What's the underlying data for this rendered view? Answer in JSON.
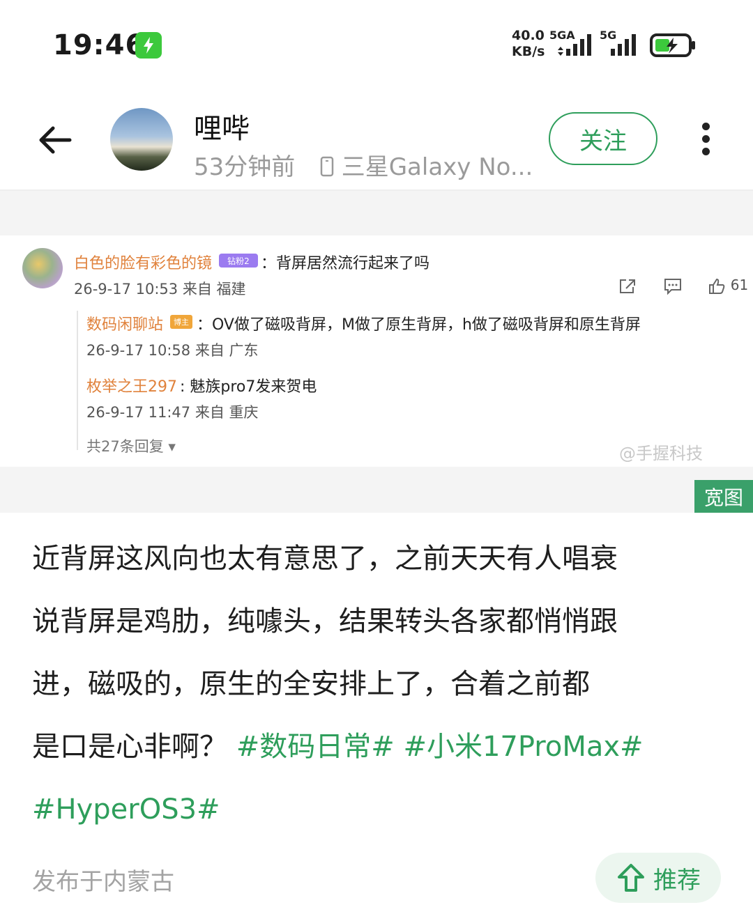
{
  "status_bar": {
    "time": "19:46",
    "net_speed_value": "40.0",
    "net_speed_unit": "KB/s",
    "sim1_label": "5GA",
    "sim2_label": "5G",
    "charging_color": "#3cc93c"
  },
  "header": {
    "username": "哩哔",
    "time_ago": "53分钟前",
    "device": "三星Galaxy No...",
    "follow_label": "关注"
  },
  "embedded_image": {
    "comment": {
      "user": "白色的脸有彩色的镜",
      "badge": "钻粉2",
      "text": "：背屏居然流行起来了吗",
      "date": "26-9-17 10:53 来自 福建",
      "like_count": "61"
    },
    "replies": [
      {
        "user": "数码闲聊站",
        "badge": "博主",
        "text": "：OV做了磁吸背屏，M做了原生背屏，h做了磁吸背屏和原生背屏",
        "date": "26-9-17 10:58 来自 广东"
      },
      {
        "user": "枚举之王297",
        "text": ": 魅族pro7发来贺电",
        "date": "26-9-17 11:47 来自 重庆"
      }
    ],
    "total_replies": "共27条回复",
    "watermark": "@手握科技",
    "wide_label": "宽图"
  },
  "post": {
    "line1": "近背屏这风向也太有意思了，之前天天有人唱衰",
    "line2": "说背屏是鸡肋，纯噱头，结果转头各家都悄悄跟",
    "line3": "进，磁吸的，原生的全安排上了，合着之前都",
    "line4_text": "是口是心非啊？",
    "tags": [
      "#数码日常#",
      "#小米17ProMax#",
      "#HyperOS3#"
    ],
    "tag_color": "#2e9e5b"
  },
  "footer": {
    "location": "发布于内蒙古",
    "recommend_label": "推荐"
  }
}
